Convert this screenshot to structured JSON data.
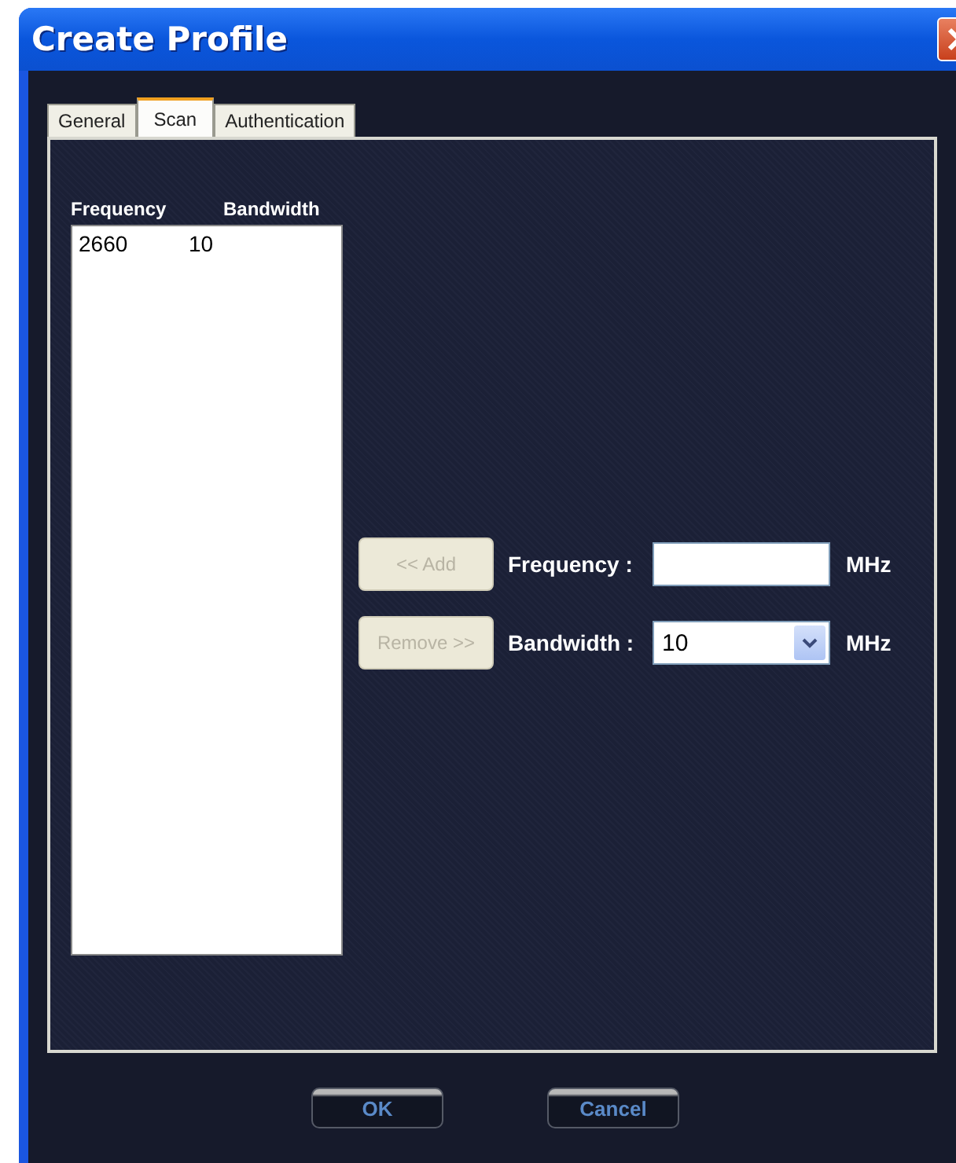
{
  "window": {
    "title": "Create Profile"
  },
  "tabs": [
    {
      "label": "General",
      "selected": false
    },
    {
      "label": "Scan",
      "selected": true
    },
    {
      "label": "Authentication",
      "selected": false
    }
  ],
  "list": {
    "columns": [
      "Frequency",
      "Bandwidth"
    ],
    "rows": [
      [
        "2660",
        "10"
      ]
    ]
  },
  "list_buttons": [
    {
      "label": "<< Add",
      "disabled": true
    },
    {
      "label": "Remove >>",
      "disabled": true
    }
  ],
  "fields": [
    {
      "kind": "text",
      "label": "Frequency :",
      "unit": "MHz"
    },
    {
      "kind": "select",
      "label": "Bandwidth :",
      "value": "10",
      "unit": "MHz"
    }
  ],
  "buttons": [
    "OK",
    "Cancel"
  ]
}
